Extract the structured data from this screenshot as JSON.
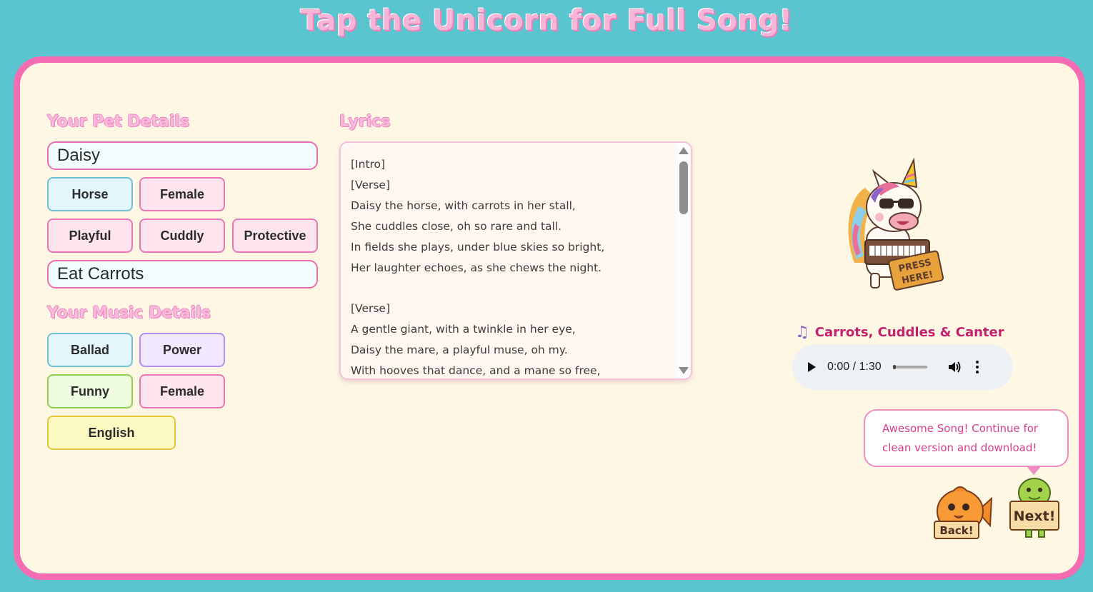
{
  "header": {
    "title": "Tap the Unicorn for Full Song!"
  },
  "pet_details": {
    "section_title": "Your Pet Details",
    "name_value": "Daisy",
    "type_chips": [
      "Horse",
      "Female"
    ],
    "trait_chips": [
      "Playful",
      "Cuddly",
      "Protective"
    ],
    "activity_value": "Eat Carrots"
  },
  "music_details": {
    "section_title": "Your Music Details",
    "chips": [
      "Ballad",
      "Power",
      "Funny",
      "Female",
      "English"
    ]
  },
  "lyrics": {
    "section_title": "Lyrics",
    "text": "[Intro]\n[Verse]\nDaisy the horse, with carrots in her stall,\nShe cuddles close, oh so rare and tall.\nIn fields she plays, under blue skies so bright,\nHer laughter echoes, as she chews the night.\n\n[Verse]\nA gentle giant, with a twinkle in her eye,\nDaisy the mare, a playful muse, oh my.\nWith hooves that dance, and a mane so free,"
  },
  "player": {
    "unicorn_sign": "PRESS HERE!",
    "song_title": "Carrots, Cuddles & Canter",
    "time": "0:00 / 1:30",
    "progress": 0
  },
  "nav": {
    "bubble_text": "Awesome Song! Continue for clean version and download!",
    "back_label": "Back!",
    "next_label": "Next!"
  },
  "colors": {
    "background": "#5bc5cf",
    "card_border": "#f46db3",
    "card_bg": "#fef7e4",
    "accent_pink": "#c3206d"
  },
  "icons": [
    "music-note-icon",
    "play-icon",
    "volume-icon",
    "more-options-icon",
    "unicorn-keyboard-icon",
    "fish-back-icon",
    "turtle-next-icon"
  ]
}
